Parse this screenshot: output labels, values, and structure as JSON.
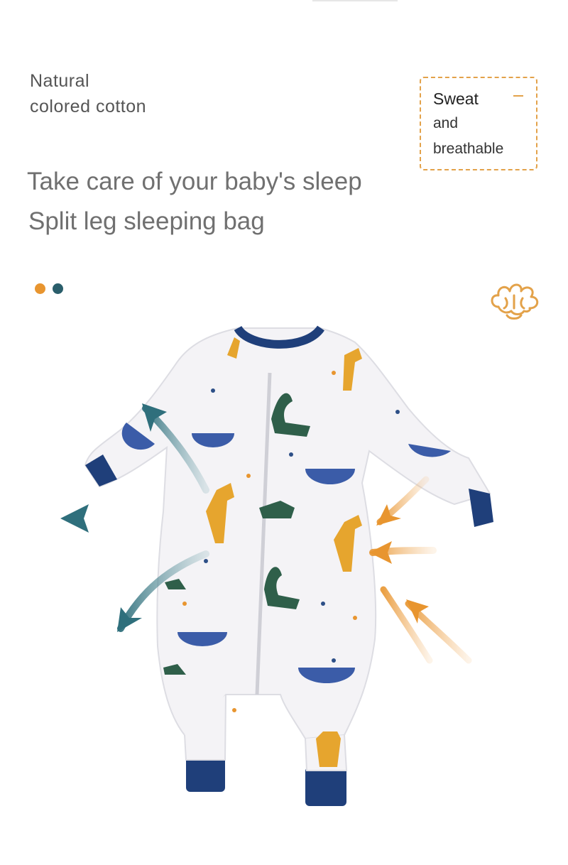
{
  "feature_left": {
    "line1": "Natural",
    "line2": "colored cotton"
  },
  "feature_right": {
    "line1": "Sweat",
    "line2": "and",
    "line3": "breathable"
  },
  "headline": "Take care of your baby's sleep",
  "subheadline": "Split leg sleeping bag",
  "color_options": [
    {
      "name": "orange",
      "color": "#e8952f"
    },
    {
      "name": "teal",
      "color": "#2a5e6b"
    }
  ],
  "icons": {
    "cotton": "cotton-icon"
  },
  "colors": {
    "accent_orange": "#e3a24a",
    "navy": "#1f3f7a",
    "teal_arrow": "#4e8a94"
  }
}
